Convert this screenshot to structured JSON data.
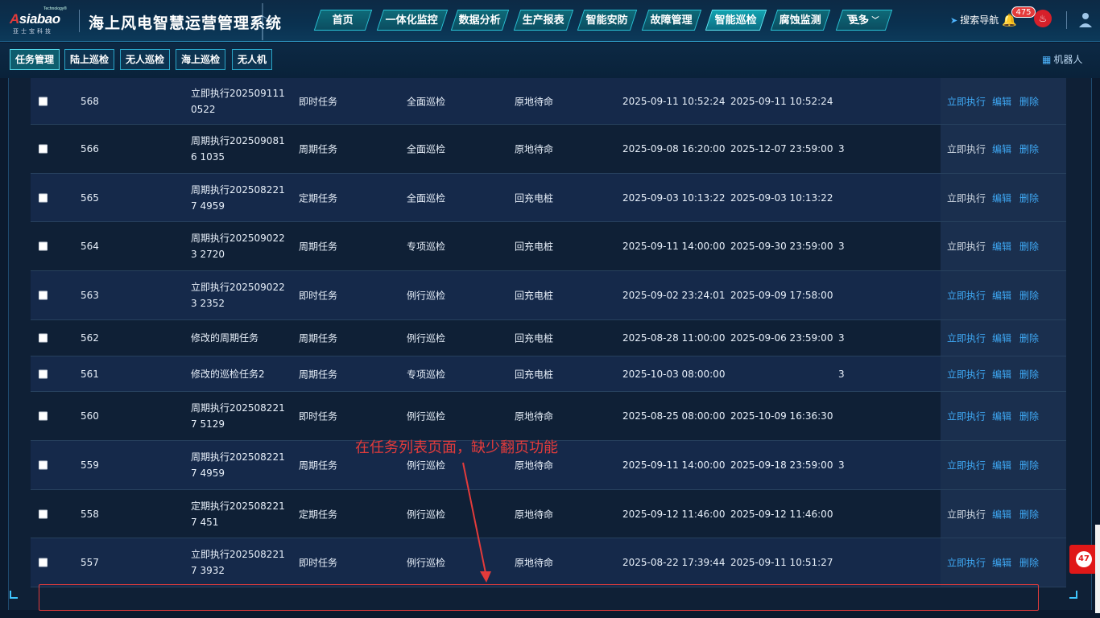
{
  "header": {
    "logo_tiny": "Technology®",
    "logo_word_a": "A",
    "logo_word_rest": "siabao",
    "logo_sub": "亚士宝科技",
    "title": "海上风电智慧运营管理系统",
    "nav": [
      {
        "label": "首页"
      },
      {
        "label": "一体化监控"
      },
      {
        "label": "数据分析"
      },
      {
        "label": "生产报表"
      },
      {
        "label": "智能安防"
      },
      {
        "label": "故障管理"
      },
      {
        "label": "智能巡检"
      },
      {
        "label": "腐蚀监测"
      },
      {
        "label": "更多"
      }
    ],
    "search_nav": "搜索导航",
    "badge": "475",
    "flag_glyph": "♨"
  },
  "subbar": {
    "tabs": [
      {
        "label": "任务管理"
      },
      {
        "label": "陆上巡检"
      },
      {
        "label": "无人巡检"
      },
      {
        "label": "海上巡检"
      },
      {
        "label": "无人机"
      }
    ],
    "robot": "机器人"
  },
  "actions": {
    "exec": "立即执行",
    "edit": "编辑",
    "delete": "删除"
  },
  "rows": [
    {
      "id": "568",
      "name": "立即执行2025091110522",
      "type": "即时任务",
      "mode": "全面巡检",
      "return": "原地待命",
      "start": "2025-09-11 10:52:24",
      "end": "2025-09-11 10:52:24",
      "cycle": ""
    },
    {
      "id": "566",
      "name": "周期执行2025090816 1035",
      "type": "周期任务",
      "mode": "全面巡检",
      "return": "原地待命",
      "start": "2025-09-08 16:20:00",
      "end": "2025-12-07 23:59:00",
      "cycle": "3"
    },
    {
      "id": "565",
      "name": "周期执行2025082217 4959",
      "type": "定期任务",
      "mode": "全面巡检",
      "return": "回充电桩",
      "start": "2025-09-03 10:13:22",
      "end": "2025-09-03 10:13:22",
      "cycle": ""
    },
    {
      "id": "564",
      "name": "周期执行2025090223 2720",
      "type": "周期任务",
      "mode": "专项巡检",
      "return": "回充电桩",
      "start": "2025-09-11 14:00:00",
      "end": "2025-09-30 23:59:00",
      "cycle": "3"
    },
    {
      "id": "563",
      "name": "立即执行2025090223 2352",
      "type": "即时任务",
      "mode": "例行巡检",
      "return": "回充电桩",
      "start": "2025-09-02 23:24:01",
      "end": "2025-09-09 17:58:00",
      "cycle": ""
    },
    {
      "id": "562",
      "name": "修改的周期任务",
      "type": "周期任务",
      "mode": "例行巡检",
      "return": "回充电桩",
      "start": "2025-08-28 11:00:00",
      "end": "2025-09-06 23:59:00",
      "cycle": "3"
    },
    {
      "id": "561",
      "name": "修改的巡检任务2",
      "type": "周期任务",
      "mode": "专项巡检",
      "return": "回充电桩",
      "start": "2025-10-03 08:00:00",
      "end": "",
      "cycle": "3"
    },
    {
      "id": "560",
      "name": "周期执行2025082217 5129",
      "type": "即时任务",
      "mode": "例行巡检",
      "return": "原地待命",
      "start": "2025-08-25 08:00:00",
      "end": "2025-10-09 16:36:30",
      "cycle": ""
    },
    {
      "id": "559",
      "name": "周期执行2025082217 4959",
      "type": "周期任务",
      "mode": "例行巡检",
      "return": "原地待命",
      "start": "2025-09-11 14:00:00",
      "end": "2025-09-18 23:59:00",
      "cycle": "3"
    },
    {
      "id": "558",
      "name": "定期执行2025082217 451",
      "type": "定期任务",
      "mode": "例行巡检",
      "return": "原地待命",
      "start": "2025-09-12 11:46:00",
      "end": "2025-09-12 11:46:00",
      "cycle": ""
    },
    {
      "id": "557",
      "name": "立即执行2025082217 3932",
      "type": "即时任务",
      "mode": "例行巡检",
      "return": "原地待命",
      "start": "2025-08-22 17:39:44",
      "end": "2025-09-11 10:51:27",
      "cycle": ""
    }
  ],
  "exec_highlight": [
    true,
    false,
    false,
    false,
    true,
    true,
    true,
    true,
    true,
    false,
    true
  ],
  "annotation": {
    "text": "在任务列表页面，缺少翻页功能",
    "color": "#e23b3b"
  },
  "float_badge": "47",
  "colors": {
    "accent": "#3fa9f5",
    "nav_active": "#13a3b1",
    "alert": "#e23b3b"
  }
}
